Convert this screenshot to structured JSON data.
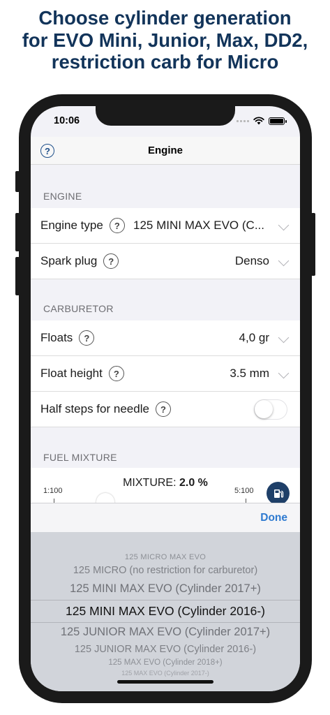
{
  "headline": [
    "Choose cylinder generation",
    "for EVO Mini, Junior, Max, DD2,",
    "restriction carb for Micro"
  ],
  "status": {
    "time": "10:06"
  },
  "navbar": {
    "help_glyph": "?",
    "title": "Engine"
  },
  "sections": {
    "engine": "ENGINE",
    "carburetor": "CARBURETOR",
    "fuel_mixture": "FUEL MIXTURE"
  },
  "rows": {
    "engine_type": {
      "label": "Engine type",
      "value": "125 MINI MAX EVO (C..."
    },
    "spark_plug": {
      "label": "Spark plug",
      "value": "Denso"
    },
    "floats": {
      "label": "Floats",
      "value": "4,0 gr"
    },
    "float_height": {
      "label": "Float height",
      "value": "3.5 mm"
    },
    "half_steps": {
      "label": "Half steps for needle",
      "enabled": false
    }
  },
  "qmark_glyph": "?",
  "mixture": {
    "min_label": "1:100",
    "max_label": "5:100",
    "title_prefix": "MIXTURE: ",
    "value": "2.0 %"
  },
  "toolbar": {
    "done_label": "Done"
  },
  "picker": {
    "items": [
      "125 MICRO MAX EVO",
      "125 MICRO (no restriction for carburetor)",
      "125 MINI MAX EVO (Cylinder 2017+)",
      "125 MINI MAX EVO (Cylinder 2016-)",
      "125 JUNIOR MAX EVO (Cylinder 2017+)",
      "125 JUNIOR MAX EVO (Cylinder 2016-)",
      "125 MAX EVO (Cylinder 2018+)",
      "125 MAX EVO (Cylinder 2017-)"
    ],
    "selected_index": 3
  },
  "colors": {
    "headline": "#12345a",
    "accent": "#2e7ad0",
    "fuel_button": "#1e3f68"
  }
}
